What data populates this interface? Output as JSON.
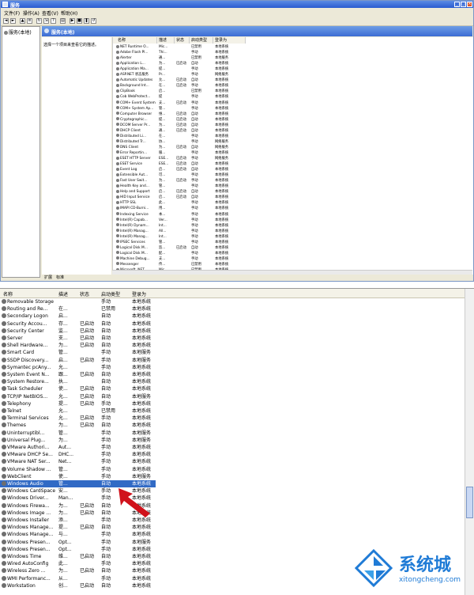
{
  "top_window": {
    "title": "服务",
    "menu": [
      "文件(F)",
      "操作(A)",
      "查看(V)",
      "帮助(H)"
    ],
    "tree_item": "服务(本地)",
    "pane_title": "服务(本地)",
    "description_hint": "选择一个项目来查看它的描述。",
    "columns": [
      "名称",
      "描述",
      "状态",
      "启动类型",
      "登录为"
    ],
    "tabs": [
      "扩展",
      "标准"
    ],
    "rows": [
      {
        "name": "NET Runtime O...",
        "desc": "Mic...",
        "status": "",
        "startup": "已禁用",
        "logon": "本地系统"
      },
      {
        "name": "Adobe Flash Pl...",
        "desc": "Thi...",
        "status": "",
        "startup": "手动",
        "logon": "本地系统"
      },
      {
        "name": "Alerter",
        "desc": "通...",
        "status": "",
        "startup": "已禁用",
        "logon": "本地服务"
      },
      {
        "name": "Application L...",
        "desc": "为...",
        "status": "已启动",
        "startup": "自动",
        "logon": "本地系统"
      },
      {
        "name": "Application Ma...",
        "desc": "提...",
        "status": "",
        "startup": "手动",
        "logon": "本地系统"
      },
      {
        "name": "ASP.NET 状态服务",
        "desc": "Pr...",
        "status": "",
        "startup": "手动",
        "logon": "网络服务"
      },
      {
        "name": "Automatic Updates",
        "desc": "允...",
        "status": "已启动",
        "startup": "自动",
        "logon": "本地系统"
      },
      {
        "name": "Background Int...",
        "desc": "在...",
        "status": "已启动",
        "startup": "手动",
        "logon": "本地系统"
      },
      {
        "name": "ClipBook",
        "desc": "启...",
        "status": "",
        "startup": "已禁用",
        "logon": "本地系统"
      },
      {
        "name": "Cob WebProtect...",
        "desc": "提",
        "status": "",
        "startup": "手动",
        "logon": "本地系统"
      },
      {
        "name": "COM+ Event System",
        "desc": "支...",
        "status": "已启动",
        "startup": "手动",
        "logon": "本地系统"
      },
      {
        "name": "COM+ System Ap...",
        "desc": "管...",
        "status": "",
        "startup": "手动",
        "logon": "本地系统"
      },
      {
        "name": "Computer Browser",
        "desc": "维...",
        "status": "已启动",
        "startup": "自动",
        "logon": "本地系统"
      },
      {
        "name": "Cryptographic...",
        "desc": "提...",
        "status": "已启动",
        "startup": "自动",
        "logon": "本地系统"
      },
      {
        "name": "DCOM Server Pr...",
        "desc": "为...",
        "status": "已启动",
        "startup": "自动",
        "logon": "本地系统"
      },
      {
        "name": "DHCP Client",
        "desc": "通...",
        "status": "已启动",
        "startup": "自动",
        "logon": "本地系统"
      },
      {
        "name": "Distributed Li...",
        "desc": "在...",
        "status": "",
        "startup": "手动",
        "logon": "本地系统"
      },
      {
        "name": "Distributed Tr...",
        "desc": "协...",
        "status": "",
        "startup": "手动",
        "logon": "网络服务"
      },
      {
        "name": "DNS Client",
        "desc": "为...",
        "status": "已启动",
        "startup": "自动",
        "logon": "网络服务"
      },
      {
        "name": "Error Reportin...",
        "desc": "服...",
        "status": "",
        "startup": "手动",
        "logon": "本地系统"
      },
      {
        "name": "ESET HTTP Server",
        "desc": "ESE...",
        "status": "已启动",
        "startup": "手动",
        "logon": "网络服务"
      },
      {
        "name": "ESET Service",
        "desc": "ESE...",
        "status": "已启动",
        "startup": "自动",
        "logon": "本地系统"
      },
      {
        "name": "Event Log",
        "desc": "启...",
        "status": "已启动",
        "startup": "自动",
        "logon": "本地系统"
      },
      {
        "name": "Extensible Aut...",
        "desc": "可...",
        "status": "",
        "startup": "手动",
        "logon": "本地系统"
      },
      {
        "name": "Fast User Swit...",
        "desc": "为...",
        "status": "已启动",
        "startup": "手动",
        "logon": "本地系统"
      },
      {
        "name": "Health Key and...",
        "desc": "管...",
        "status": "",
        "startup": "手动",
        "logon": "本地系统"
      },
      {
        "name": "Help and Support",
        "desc": "启...",
        "status": "已启动",
        "startup": "自动",
        "logon": "本地系统"
      },
      {
        "name": "HID Input Service",
        "desc": "启...",
        "status": "已启动",
        "startup": "自动",
        "logon": "本地系统"
      },
      {
        "name": "HTTP SSL",
        "desc": "此...",
        "status": "",
        "startup": "手动",
        "logon": "本地系统"
      },
      {
        "name": "IMAPI CD-Burni...",
        "desc": "用...",
        "status": "",
        "startup": "手动",
        "logon": "本地系统"
      },
      {
        "name": "Indexing Service",
        "desc": "本...",
        "status": "",
        "startup": "手动",
        "logon": "本地系统"
      },
      {
        "name": "Intel(R) Capab...",
        "desc": "Ver...",
        "status": "",
        "startup": "手动",
        "logon": "本地系统"
      },
      {
        "name": "Intel(R) Dynam...",
        "desc": "Int...",
        "status": "",
        "startup": "手动",
        "logon": "本地系统"
      },
      {
        "name": "Intel(R) Manag...",
        "desc": "All...",
        "status": "",
        "startup": "手动",
        "logon": "本地系统"
      },
      {
        "name": "Intel(R) Manag...",
        "desc": "Int...",
        "status": "",
        "startup": "手动",
        "logon": "本地系统"
      },
      {
        "name": "IPSEC Services",
        "desc": "管...",
        "status": "",
        "startup": "手动",
        "logon": "本地系统"
      },
      {
        "name": "Logical Disk M...",
        "desc": "监...",
        "status": "已启动",
        "startup": "自动",
        "logon": "本地系统"
      },
      {
        "name": "Logical Disk M...",
        "desc": "配...",
        "status": "",
        "startup": "手动",
        "logon": "本地系统"
      },
      {
        "name": "Machine Debug...",
        "desc": "支...",
        "status": "",
        "startup": "手动",
        "logon": "本地系统"
      },
      {
        "name": "Messenger",
        "desc": "传...",
        "status": "",
        "startup": "已禁用",
        "logon": "本地系统"
      },
      {
        "name": "Microsoft .NET...",
        "desc": "Mic...",
        "status": "",
        "startup": "已禁用",
        "logon": "本地系统"
      }
    ]
  },
  "bottom_window": {
    "columns": [
      "名称",
      "描述",
      "状态",
      "启动类型",
      "登录为"
    ],
    "rows": [
      {
        "name": "Removable Storage",
        "desc": "",
        "status": "",
        "startup": "手动",
        "logon": "本地系统"
      },
      {
        "name": "Routing and Re...",
        "desc": "在...",
        "status": "",
        "startup": "已禁用",
        "logon": "本地系统"
      },
      {
        "name": "Secondary Logon",
        "desc": "启...",
        "status": "",
        "startup": "自动",
        "logon": "本地系统"
      },
      {
        "name": "Security Accou...",
        "desc": "存...",
        "status": "已启动",
        "startup": "自动",
        "logon": "本地系统"
      },
      {
        "name": "Security Center",
        "desc": "监...",
        "status": "已启动",
        "startup": "自动",
        "logon": "本地系统"
      },
      {
        "name": "Server",
        "desc": "支...",
        "status": "已启动",
        "startup": "自动",
        "logon": "本地系统"
      },
      {
        "name": "Shell Hardware...",
        "desc": "为...",
        "status": "已启动",
        "startup": "自动",
        "logon": "本地系统"
      },
      {
        "name": "Smart Card",
        "desc": "管...",
        "status": "",
        "startup": "手动",
        "logon": "本地服务"
      },
      {
        "name": "SSDP Discovery...",
        "desc": "启...",
        "status": "已启动",
        "startup": "手动",
        "logon": "本地服务"
      },
      {
        "name": "Symantec pcAny...",
        "desc": "允...",
        "status": "",
        "startup": "手动",
        "logon": "本地系统"
      },
      {
        "name": "System Event N...",
        "desc": "跟...",
        "status": "已启动",
        "startup": "自动",
        "logon": "本地系统"
      },
      {
        "name": "System Restore...",
        "desc": "执...",
        "status": "",
        "startup": "自动",
        "logon": "本地系统"
      },
      {
        "name": "Task Scheduler",
        "desc": "使...",
        "status": "已启动",
        "startup": "自动",
        "logon": "本地系统"
      },
      {
        "name": "TCP/IP NetBIOS...",
        "desc": "允...",
        "status": "已启动",
        "startup": "自动",
        "logon": "本地服务"
      },
      {
        "name": "Telephony",
        "desc": "提...",
        "status": "已启动",
        "startup": "手动",
        "logon": "本地系统"
      },
      {
        "name": "Telnet",
        "desc": "允...",
        "status": "",
        "startup": "已禁用",
        "logon": "本地系统"
      },
      {
        "name": "Terminal Services",
        "desc": "允...",
        "status": "已启动",
        "startup": "手动",
        "logon": "本地系统"
      },
      {
        "name": "Themes",
        "desc": "为...",
        "status": "已启动",
        "startup": "自动",
        "logon": "本地系统"
      },
      {
        "name": "Uninterruptibl...",
        "desc": "管...",
        "status": "",
        "startup": "手动",
        "logon": "本地服务"
      },
      {
        "name": "Universal Plug...",
        "desc": "为...",
        "status": "",
        "startup": "手动",
        "logon": "本地服务"
      },
      {
        "name": "VMware Authori...",
        "desc": "Aut...",
        "status": "",
        "startup": "手动",
        "logon": "本地系统"
      },
      {
        "name": "VMware DHCP Se...",
        "desc": "DHC...",
        "status": "",
        "startup": "手动",
        "logon": "本地系统"
      },
      {
        "name": "VMware NAT Ser...",
        "desc": "Net...",
        "status": "",
        "startup": "手动",
        "logon": "本地系统"
      },
      {
        "name": "Volume Shadow ...",
        "desc": "管...",
        "status": "",
        "startup": "手动",
        "logon": "本地系统"
      },
      {
        "name": "WebClient",
        "desc": "使...",
        "status": "",
        "startup": "手动",
        "logon": "本地服务"
      },
      {
        "name": "Windows Audio",
        "desc": "管...",
        "status": "",
        "startup": "自动",
        "logon": "本地系统",
        "selected": true
      },
      {
        "name": "Windows CardSpace",
        "desc": "安...",
        "status": "",
        "startup": "手动",
        "logon": "本地系统"
      },
      {
        "name": "Windows Driver...",
        "desc": "Man...",
        "status": "",
        "startup": "手动",
        "logon": "本地系统"
      },
      {
        "name": "Windows Firewa...",
        "desc": "为...",
        "status": "已启动",
        "startup": "自动",
        "logon": "本地系统"
      },
      {
        "name": "Windows Image ...",
        "desc": "为...",
        "status": "已启动",
        "startup": "自动",
        "logon": "本地系统"
      },
      {
        "name": "Windows Installer",
        "desc": "添...",
        "status": "",
        "startup": "手动",
        "logon": "本地系统"
      },
      {
        "name": "Windows Manage...",
        "desc": "提...",
        "status": "已启动",
        "startup": "自动",
        "logon": "本地系统"
      },
      {
        "name": "Windows Manage...",
        "desc": "与...",
        "status": "",
        "startup": "手动",
        "logon": "本地系统"
      },
      {
        "name": "Windows Presen...",
        "desc": "Opt...",
        "status": "",
        "startup": "手动",
        "logon": "本地服务"
      },
      {
        "name": "Windows Presen...",
        "desc": "Opt...",
        "status": "",
        "startup": "手动",
        "logon": "本地系统"
      },
      {
        "name": "Windows Time",
        "desc": "维...",
        "status": "已启动",
        "startup": "自动",
        "logon": "本地系统"
      },
      {
        "name": "Wired AutoConfig",
        "desc": "此...",
        "status": "",
        "startup": "手动",
        "logon": "本地系统"
      },
      {
        "name": "Wireless Zero ...",
        "desc": "为...",
        "status": "已启动",
        "startup": "自动",
        "logon": "本地系统"
      },
      {
        "name": "WMI Performanc...",
        "desc": "从...",
        "status": "",
        "startup": "手动",
        "logon": "本地系统"
      },
      {
        "name": "Workstation",
        "desc": "创...",
        "status": "已启动",
        "startup": "自动",
        "logon": "本地系统"
      }
    ]
  },
  "watermark": {
    "brand": "系统城",
    "url": "xitongcheng.com"
  },
  "colors": {
    "selection": "#316ac5",
    "titlebar": "#2a5bd0",
    "arrow": "#d0121b",
    "brand": "#1f7bd6"
  }
}
